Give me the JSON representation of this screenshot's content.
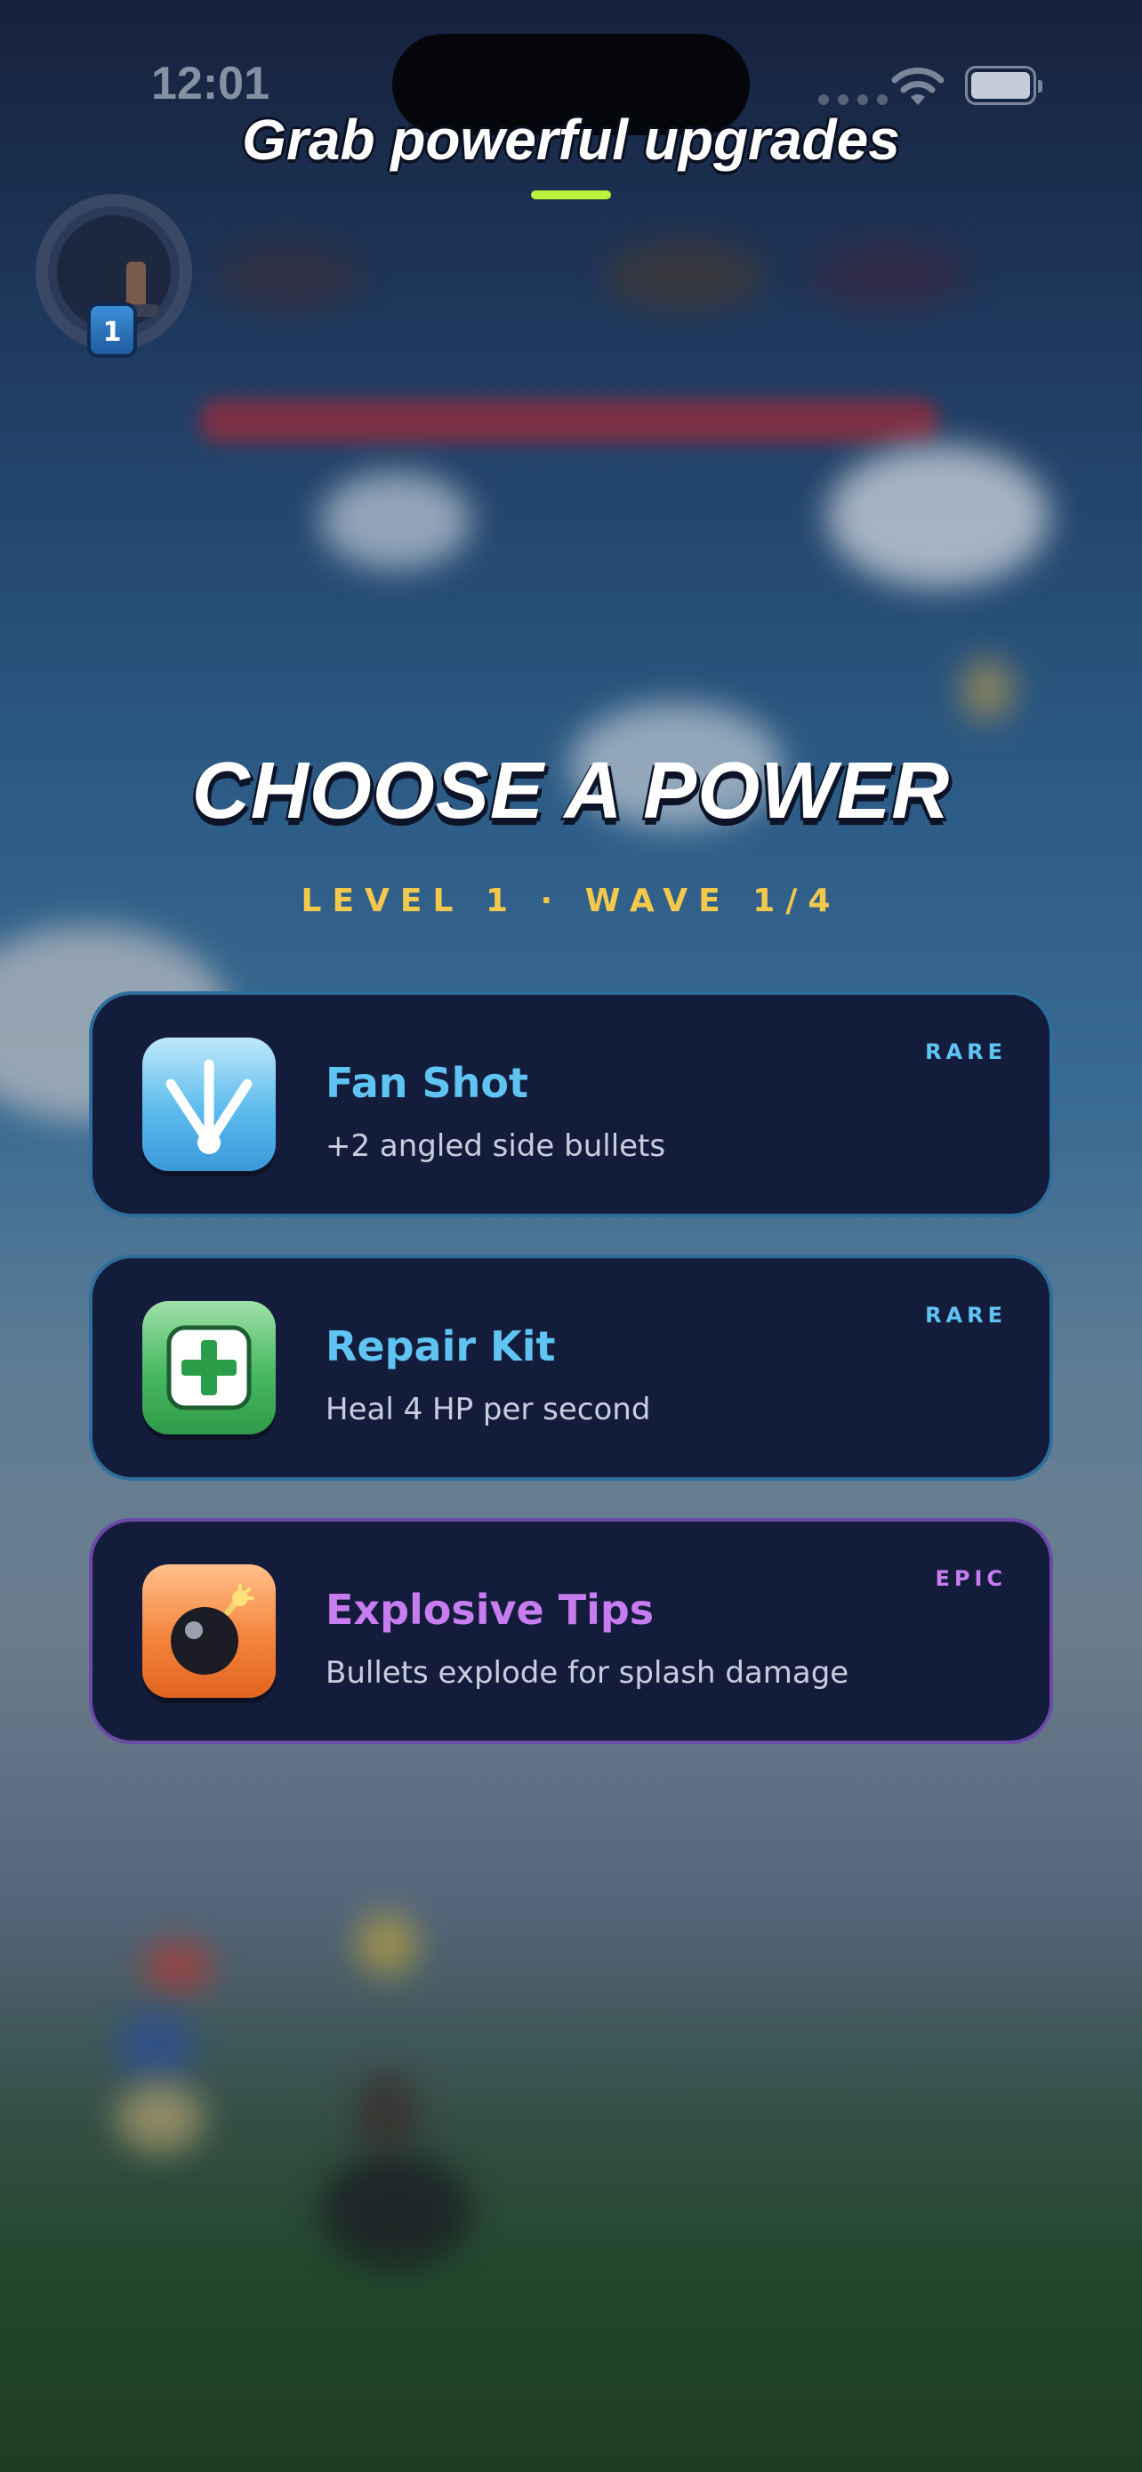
{
  "status_bar": {
    "time": "12:01"
  },
  "tutorial": {
    "caption": "Grab powerful upgrades"
  },
  "player": {
    "level": "1"
  },
  "header": {
    "title": "CHOOSE A POWER",
    "subtitle": "LEVEL 1 · WAVE 1/4"
  },
  "powers": [
    {
      "name": "Fan Shot",
      "description": "+2 angled side bullets",
      "rarity": "RARE",
      "icon": "fan-shot-icon",
      "color": "#5fc4f2"
    },
    {
      "name": "Repair Kit",
      "description": "Heal 4 HP per second",
      "rarity": "RARE",
      "icon": "repair-kit-icon",
      "color": "#5fc4f2"
    },
    {
      "name": "Explosive Tips",
      "description": "Bullets explode for splash damage",
      "rarity": "EPIC",
      "icon": "bomb-icon",
      "color": "#c77df0"
    }
  ]
}
